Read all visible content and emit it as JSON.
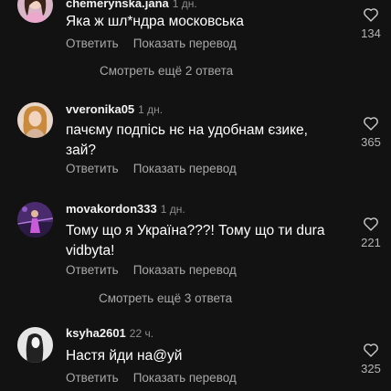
{
  "comments": [
    {
      "username": "chemerynska.jana",
      "time": "1 дн.",
      "text": "Яка ж шл*ндра московська",
      "reply": "Ответить",
      "translate": "Показать перевод",
      "likes": "134"
    },
    {
      "username": "vveronika05",
      "time": "1 дн.",
      "text": "пачєму подпісь нє на удобнам єзике, зай?",
      "reply": "Ответить",
      "translate": "Показать перевод",
      "likes": "365"
    },
    {
      "username": "movakordon333",
      "time": "1 дн.",
      "text": "Тому що я Україна???! Тому що ти dura vidbyta!",
      "reply": "Ответить",
      "translate": "Показать перевод",
      "likes": "221"
    },
    {
      "username": "ksyha2601",
      "time": "22 ч.",
      "text": "Настя йди на@уй",
      "reply": "Ответить",
      "translate": "Показать перевод",
      "likes": "325"
    }
  ],
  "view_more": [
    "Смотреть ещё 2 ответа",
    "Смотреть ещё 3 ответа"
  ],
  "icons": {
    "like": "heart-outline-icon"
  },
  "colors": {
    "background": "#121212",
    "secondary_text": "#a8a8a8"
  }
}
